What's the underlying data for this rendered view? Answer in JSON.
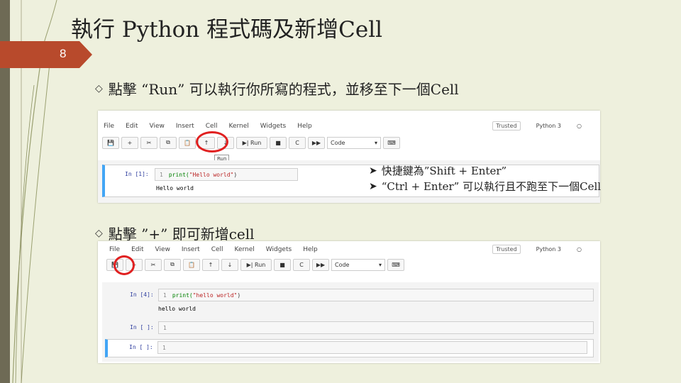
{
  "slide": {
    "title": "執行 Python 程式碼及新增Cell",
    "number": "8",
    "bullet1": "點擊 “Run” 可以執行你所寫的程式，並移至下一個Cell",
    "bullet2": "點擊 ”+” 即可新增cell",
    "note1": "快捷鍵為”Shift + Enter”",
    "note2": "“Ctrl + Enter” 可以執行且不跑至下一個Cell",
    "accent_color": "#b84a2c"
  },
  "notebook": {
    "menu": [
      "File",
      "Edit",
      "View",
      "Insert",
      "Cell",
      "Kernel",
      "Widgets",
      "Help"
    ],
    "trusted": "Trusted",
    "kernel": "Python 3",
    "toolbar": {
      "save": "💾",
      "add": "+",
      "cut": "✂",
      "copy": "⧉",
      "paste": "📋",
      "up": "↑",
      "down": "↓",
      "run": "▶| Run",
      "stop": "■",
      "restart": "C",
      "restart_run": "▶▶",
      "celltype": "Code",
      "keyboard": "⌨",
      "tooltip": "Run"
    }
  },
  "shot1": {
    "cells": [
      {
        "prompt": "In [1]:",
        "line": "1",
        "code_fn": "print(",
        "code_str": "\"Hello world\"",
        "code_end": ")",
        "output": "Hello world"
      }
    ]
  },
  "shot2": {
    "cells": [
      {
        "prompt": "In [4]:",
        "line": "1",
        "code_fn": "print(",
        "code_str": "\"hello world\"",
        "code_end": ")",
        "output": "hello world"
      },
      {
        "prompt": "In [ ]:",
        "line": "1"
      },
      {
        "prompt": "In [ ]:",
        "line": "1"
      }
    ]
  }
}
